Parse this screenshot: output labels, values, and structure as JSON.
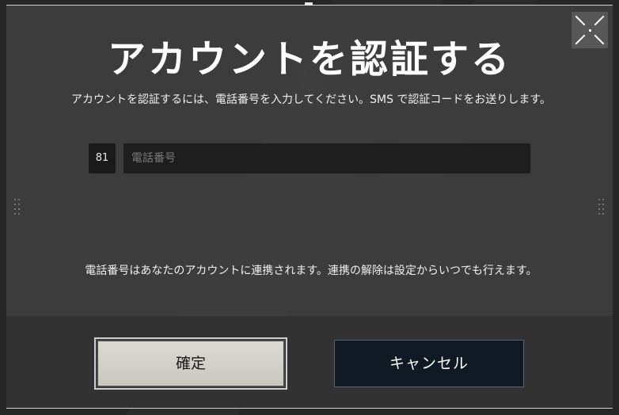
{
  "dialog": {
    "title": "アカウントを認証する",
    "description": "アカウントを認証するには、電話番号を入力してください。SMS で認証コードをお送りします。",
    "country_code": "81",
    "phone_placeholder": "電話番号",
    "phone_value": "",
    "note": "電話番号はあなたのアカウントに連携されます。連携の解除は設定からいつでも行えます。",
    "confirm_label": "確定",
    "cancel_label": "キャンセル"
  },
  "icons": {
    "fullscreen": "fullscreen-exit-icon"
  },
  "colors": {
    "confirm_bg": "#d6d4ce",
    "cancel_bg": "#101a24",
    "dialog_bg": "#3e3e3e"
  }
}
